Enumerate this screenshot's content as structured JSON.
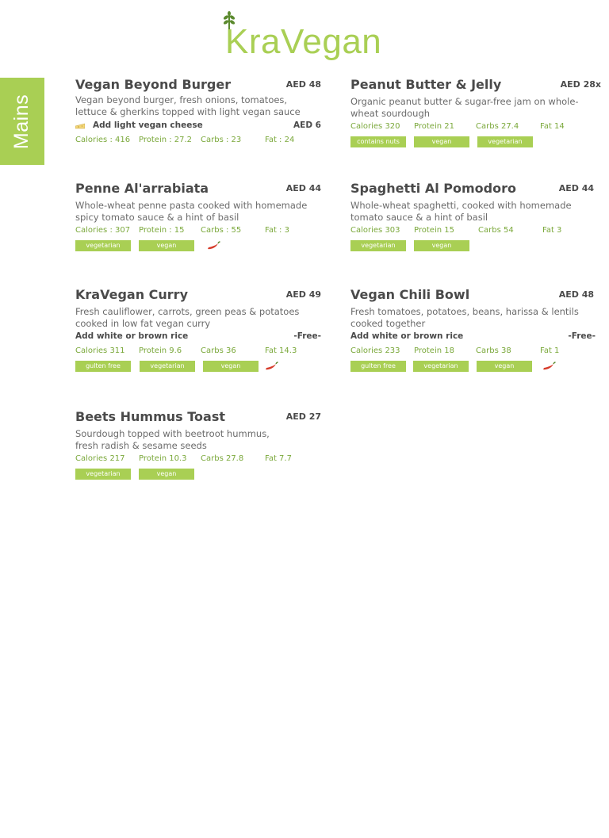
{
  "brand": {
    "name": "KraVegan"
  },
  "section": {
    "title": "Mains"
  },
  "colors": {
    "accent": "#a9cf54",
    "text": "#4a4a4a",
    "nutrition": "#7aa83a"
  },
  "items": [
    {
      "name": "Vegan Beyond Burger",
      "price": "AED 48",
      "description": "Vegan beyond burger, fresh onions, tomatoes, lettuce & gherkins topped with light vegan sauce",
      "addon": {
        "label": "Add light vegan cheese",
        "price": "AED 6"
      },
      "nutrition": {
        "calories": "Calories : 416",
        "protein": "Protein : 27.2",
        "carbs": "Carbs : 23",
        "fat": "Fat : 24"
      },
      "tags": []
    },
    {
      "name": "Peanut Butter & Jelly",
      "price": "AED 28x",
      "description": "Organic peanut butter & sugar-free jam on whole-wheat sourdough",
      "nutrition": {
        "calories": "Calories 320",
        "protein": "Protein 21",
        "carbs": "Carbs 27.4",
        "fat": "Fat 14"
      },
      "tags": [
        "contains nuts",
        "vegan",
        "vegetarian"
      ]
    },
    {
      "name": "Penne Al'arrabiata",
      "price": "AED 44",
      "description": "Whole-wheat penne pasta cooked with homemade spicy tomato sauce & a hint of basil",
      "nutrition": {
        "calories": "Calories : 307",
        "protein": "Protein : 15",
        "carbs": "Carbs : 55",
        "fat": "Fat : 3"
      },
      "tags": [
        "vegetarian",
        "vegan"
      ]
    },
    {
      "name": "Spaghetti Al Pomodoro",
      "price": "AED 44",
      "description": "Whole-wheat spaghetti, cooked with homemade tomato sauce & a hint of basil",
      "nutrition": {
        "calories": "Calories 303",
        "protein": "Protein 15",
        "carbs": "Carbs 54",
        "fat": "Fat 3"
      },
      "tags": [
        "vegetarian",
        "vegan"
      ]
    },
    {
      "name": "KraVegan Curry",
      "price": "AED 49",
      "description": "Fresh cauliflower, carrots, green peas & potatoes cooked in low fat vegan curry",
      "addon": {
        "label": "Add white or brown rice",
        "price": "-Free-"
      },
      "nutrition": {
        "calories": "Calories 311",
        "protein": "Protein 9.6",
        "carbs": "Carbs 36",
        "fat": "Fat 14.3"
      },
      "tags": [
        "gulten free",
        "vegetarian",
        "vegan"
      ]
    },
    {
      "name": "Vegan Chili Bowl",
      "price": "AED 48",
      "description": "Fresh tomatoes, potatoes, beans, harissa & lentils cooked together",
      "addon": {
        "label": "Add white or brown rice",
        "price": "-Free-"
      },
      "nutrition": {
        "calories": "Calories 233",
        "protein": "Protein 18",
        "carbs": "Carbs 38",
        "fat": "Fat 1"
      },
      "tags": [
        "gulten free",
        "vegetarian",
        "vegan"
      ]
    },
    {
      "name": "Beets Hummus Toast",
      "price": "AED 27",
      "description": "Sourdough topped with beetroot hummus, fresh radish & sesame seeds",
      "nutrition": {
        "calories": "Calories 217",
        "protein": "Protein 10.3",
        "carbs": "Carbs 27.8",
        "fat": "Fat 7.7"
      },
      "tags": [
        "vegetarian",
        "vegan"
      ]
    }
  ]
}
